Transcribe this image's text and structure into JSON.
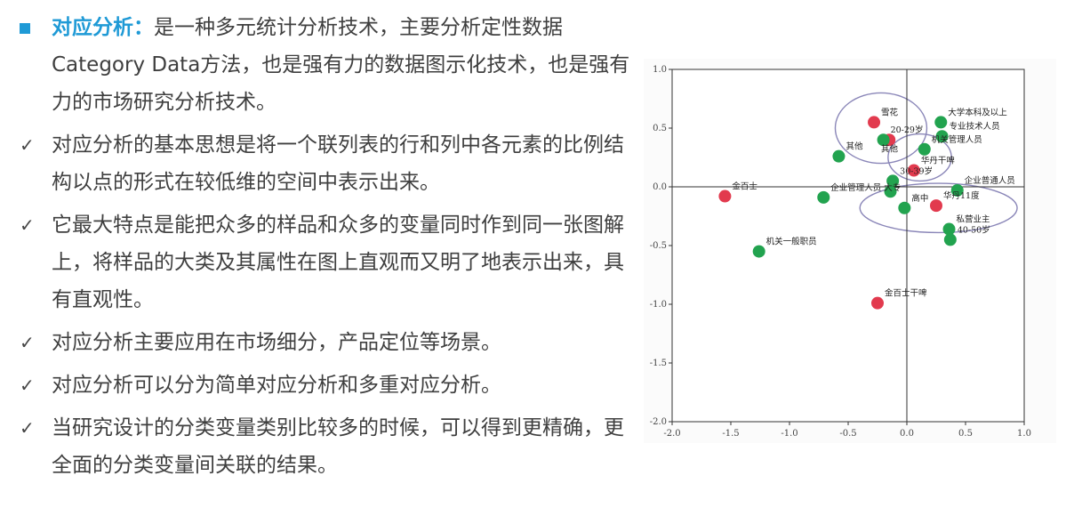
{
  "colors": {
    "accent": "#1f9ad6",
    "point_red": "#e23a4e",
    "point_green": "#22a34f",
    "circle": "#8a86b8"
  },
  "intro": {
    "highlight": "对应分析：",
    "text": "是一种多元统计分析技术，主要分析定性数据Category Data方法，也是强有力的数据图示化技术，也是强有力的市场研究分析技术。"
  },
  "bullets": [
    "对应分析的基本思想是将一个联列表的行和列中各元素的比例结构以点的形式在较低维的空间中表示出来。",
    "它最大特点是能把众多的样品和众多的变量同时作到同一张图解上，将样品的大类及其属性在图上直观而又明了地表示出来，具有直观性。",
    "对应分析主要应用在市场细分，产品定位等场景。",
    "对应分析可以分为简单对应分析和多重对应分析。",
    "当研究设计的分类变量类别比较多的时候，可以得到更精确，更全面的分类变量间关联的结果。"
  ],
  "chart_data": {
    "type": "scatter",
    "xlim": [
      -2.0,
      1.0
    ],
    "ylim": [
      -2.0,
      1.0
    ],
    "x_ticks": [
      "-2.0",
      "-1.5",
      "-1.0",
      "-0.5",
      "0.0",
      "0.5",
      "1.0"
    ],
    "y_ticks": [
      "1.0",
      "0.5",
      "0.0",
      "-0.5",
      "-1.0",
      "-1.5",
      "-2.0"
    ],
    "series": [
      {
        "color": "red",
        "points": [
          {
            "x": -1.55,
            "y": -0.08,
            "label": "金百士"
          },
          {
            "x": -0.28,
            "y": 0.55,
            "label": "雪花"
          },
          {
            "x": -0.15,
            "y": 0.4,
            "label": ""
          },
          {
            "x": 0.06,
            "y": 0.14,
            "label": "华丹干啤"
          },
          {
            "x": 0.25,
            "y": -0.16,
            "label": "华丹11度"
          },
          {
            "x": -0.25,
            "y": -0.99,
            "label": "金百士干啤"
          }
        ]
      },
      {
        "color": "green",
        "points": [
          {
            "x": 0.29,
            "y": 0.55,
            "label": "大学本科及以上"
          },
          {
            "x": 0.3,
            "y": 0.43,
            "label": "专业技术人员"
          },
          {
            "x": 0.15,
            "y": 0.32,
            "label": "机关管理人员"
          },
          {
            "x": -0.2,
            "y": 0.4,
            "label": "20-29岁"
          },
          {
            "x": -0.58,
            "y": 0.26,
            "label": "其他"
          },
          {
            "x": -0.12,
            "y": 0.05,
            "label": "30-39岁"
          },
          {
            "x": -0.14,
            "y": -0.04,
            "label": ""
          },
          {
            "x": -0.71,
            "y": -0.09,
            "label": "企业管理人员 大专"
          },
          {
            "x": 0.43,
            "y": -0.03,
            "label": "企业普通人员"
          },
          {
            "x": -0.02,
            "y": -0.18,
            "label": "高中"
          },
          {
            "x": 0.36,
            "y": -0.36,
            "label": "私营业主"
          },
          {
            "x": 0.37,
            "y": -0.45,
            "label": "40-50岁"
          },
          {
            "x": -1.26,
            "y": -0.55,
            "label": "机关一般职员"
          }
        ]
      }
    ],
    "free_labels": [
      "其他"
    ]
  }
}
